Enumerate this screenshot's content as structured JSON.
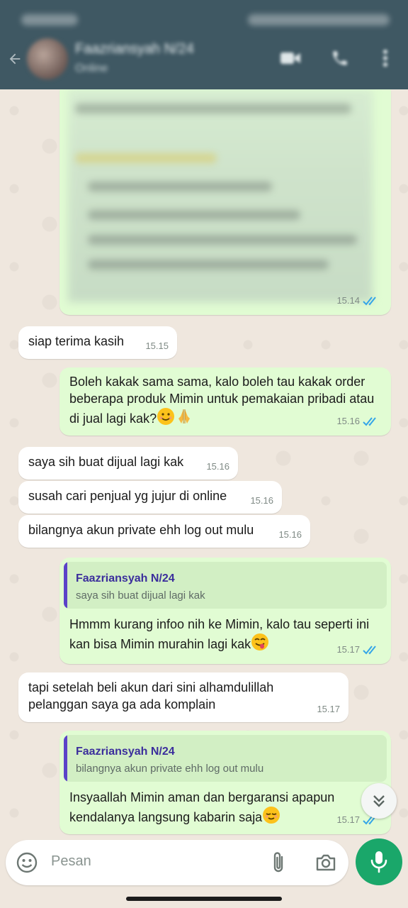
{
  "header": {
    "contact_name": "Faazriansyah N/24",
    "contact_status": "Online"
  },
  "messages": [
    {
      "id": "m0",
      "type": "out",
      "kind": "image",
      "time": "15.14"
    },
    {
      "id": "m1",
      "type": "in",
      "text": "siap terima kasih",
      "time": "15.15"
    },
    {
      "id": "m2",
      "type": "out",
      "text": "Boleh kakak sama sama, kalo boleh tau kakak order beberapa produk Mimin untuk pemakaian pribadi atau di jual lagi kak?",
      "emojis": [
        "smiling-face-emoji",
        "folded-hands-emoji"
      ],
      "time": "15.16"
    },
    {
      "id": "m3",
      "type": "in",
      "text": "saya sih buat dijual lagi kak",
      "time": "15.16"
    },
    {
      "id": "m4",
      "type": "in",
      "text": "susah cari penjual yg jujur di online",
      "time": "15.16"
    },
    {
      "id": "m5",
      "type": "in",
      "text": "bilangnya akun private ehh log out mulu",
      "time": "15.16"
    },
    {
      "id": "m6",
      "type": "out",
      "quote_name": "Faazriansyah N/24",
      "quote_text": "saya sih buat dijual lagi kak",
      "text": "Hmmm kurang infoo nih ke Mimin, kalo tau seperti ini kan bisa Mimin murahin lagi kak",
      "emojis": [
        "yum-face-emoji"
      ],
      "time": "15.17"
    },
    {
      "id": "m7",
      "type": "in",
      "text": "tapi setelah beli akun dari sini alhamdulillah pelanggan saya ga ada komplain",
      "time": "15.17"
    },
    {
      "id": "m8",
      "type": "out",
      "quote_name": "Faazriansyah N/24",
      "quote_text": "bilangnya akun private ehh log out mulu",
      "text": "Insyaallah Mimin aman dan bergaransi apapun kendalanya langsung kabarin saja",
      "emojis": [
        "relieved-face-emoji"
      ],
      "time": "15.17"
    }
  ],
  "input": {
    "placeholder": "Pesan"
  },
  "colors": {
    "header_bg": "#3f5863",
    "chat_bg": "#efe7de",
    "incoming_bubble": "#ffffff",
    "outgoing_bubble": "#e1fcd3",
    "quote_bar": "#5b43c8",
    "read_ticks": "#34a5e8",
    "mic_button": "#1aa76a"
  }
}
